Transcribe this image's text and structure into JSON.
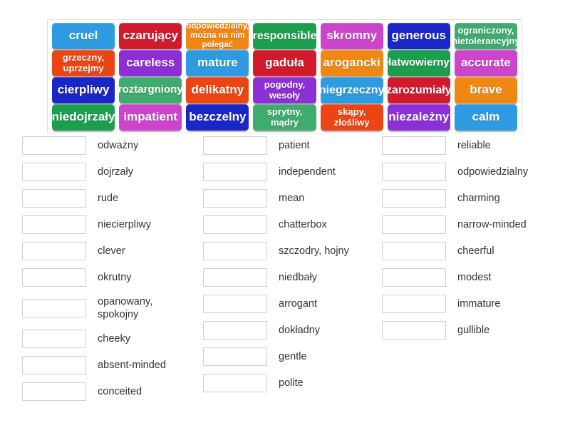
{
  "activity": {
    "type": "match-up-drag-drop",
    "tile_text_color": "#ffffff"
  },
  "tile_bank": {
    "border_color": "#e2dcdc",
    "rows": [
      [
        {
          "label": "cruel",
          "color": "#2e9be0",
          "size": "normal"
        },
        {
          "label": "czarujący",
          "color": "#cf1b2b",
          "size": "normal"
        },
        {
          "label": "odpowiedzialny, można na nim polegać",
          "color": "#f18713",
          "size": "small"
        },
        {
          "label": "responsible",
          "color": "#1c9e4e",
          "size": "t16"
        },
        {
          "label": "skromny",
          "color": "#cc44cc",
          "size": "normal"
        },
        {
          "label": "generous",
          "color": "#1a27c6",
          "size": "normal"
        },
        {
          "label": "ograniczony, nietolerancyjny",
          "color": "#3fab6e",
          "size": "medium"
        }
      ],
      [
        {
          "label": "grzeczny, uprzejmy",
          "color": "#ea4513",
          "size": "medium"
        },
        {
          "label": "careless",
          "color": "#8c2fd6",
          "size": "normal"
        },
        {
          "label": "mature",
          "color": "#2e9be0",
          "size": "normal"
        },
        {
          "label": "gaduła",
          "color": "#cf1b2b",
          "size": "normal"
        },
        {
          "label": "arogancki",
          "color": "#f18713",
          "size": "normal"
        },
        {
          "label": "łatwowierny",
          "color": "#1c9e4e",
          "size": "t15"
        },
        {
          "label": "accurate",
          "color": "#cc44cc",
          "size": "normal"
        }
      ],
      [
        {
          "label": "cierpliwy",
          "color": "#1a27c6",
          "size": "normal"
        },
        {
          "label": "roztargniony",
          "color": "#3fab6e",
          "size": "t15"
        },
        {
          "label": "delikatny",
          "color": "#ea4513",
          "size": "normal"
        },
        {
          "label": "pogodny, wesoły",
          "color": "#8c2fd6",
          "size": "medium"
        },
        {
          "label": "niegrzeczny",
          "color": "#2e9be0",
          "size": "t16"
        },
        {
          "label": "zarozumiały",
          "color": "#cf1b2b",
          "size": "t16"
        },
        {
          "label": "brave",
          "color": "#f18713",
          "size": "normal"
        }
      ],
      [
        {
          "label": "niedojrzały",
          "color": "#1c9e4e",
          "size": "normal"
        },
        {
          "label": "impatient",
          "color": "#cc44cc",
          "size": "normal"
        },
        {
          "label": "bezczelny",
          "color": "#1a27c6",
          "size": "normal"
        },
        {
          "label": "sprytny, mądry",
          "color": "#3fab6e",
          "size": "medium"
        },
        {
          "label": "skąpy, złośliwy",
          "color": "#ea4513",
          "size": "medium"
        },
        {
          "label": "niezależny",
          "color": "#8c2fd6",
          "size": "normal"
        },
        {
          "label": "calm",
          "color": "#2e9be0",
          "size": "normal"
        }
      ]
    ]
  },
  "answer_list": {
    "drop_box_placeholder": "",
    "columns": [
      {
        "items": [
          {
            "label": "odważny",
            "lines": 1
          },
          {
            "label": "dojrzały",
            "lines": 1
          },
          {
            "label": "rude",
            "lines": 1
          },
          {
            "label": "niecierpliwy",
            "lines": 1
          },
          {
            "label": "clever",
            "lines": 1
          },
          {
            "label": "okrutny",
            "lines": 1
          },
          {
            "label": "opanowany, spokojny",
            "lines": 2
          },
          {
            "label": "cheeky",
            "lines": 1
          },
          {
            "label": "absent-minded",
            "lines": 1
          },
          {
            "label": "conceited",
            "lines": 1
          }
        ]
      },
      {
        "items": [
          {
            "label": "patient",
            "lines": 1
          },
          {
            "label": "independent",
            "lines": 1
          },
          {
            "label": "mean",
            "lines": 1
          },
          {
            "label": "chatterbox",
            "lines": 1
          },
          {
            "label": "szczodry, hojny",
            "lines": 1
          },
          {
            "label": "niedbały",
            "lines": 1
          },
          {
            "label": "arrogant",
            "lines": 1
          },
          {
            "label": "dokładny",
            "lines": 1
          },
          {
            "label": "gentle",
            "lines": 1
          },
          {
            "label": "polite",
            "lines": 1
          }
        ]
      },
      {
        "items": [
          {
            "label": "reliable",
            "lines": 1
          },
          {
            "label": "odpowiedzialny",
            "lines": 1
          },
          {
            "label": "charming",
            "lines": 1
          },
          {
            "label": "narrow-minded",
            "lines": 1
          },
          {
            "label": "cheerful",
            "lines": 1
          },
          {
            "label": "modest",
            "lines": 1
          },
          {
            "label": "immature",
            "lines": 1
          },
          {
            "label": "gullible",
            "lines": 1
          }
        ]
      }
    ]
  }
}
